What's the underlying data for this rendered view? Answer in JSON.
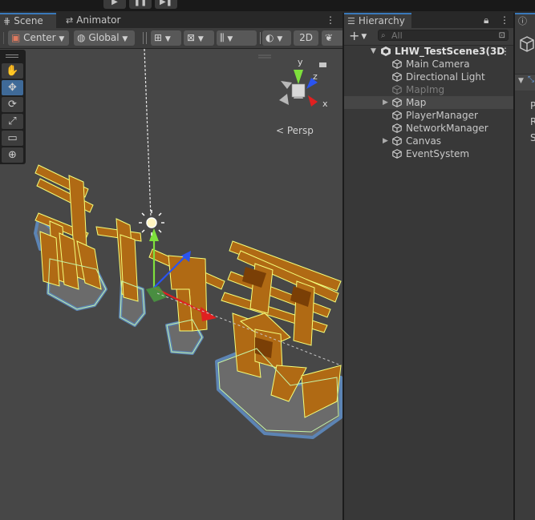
{
  "playbar": {
    "buttons": [
      "▶",
      "❚❚",
      "▶❚"
    ]
  },
  "scene_tabs": {
    "scene_label": "Scene",
    "animator_label": "Animator",
    "menu_glyph": "⋮"
  },
  "toolbar": {
    "pivot_label": "Center",
    "space_label": "Global",
    "mode_2d_label": "2D"
  },
  "scene": {
    "projection_label": "< Persp",
    "gizmo_axes": {
      "x": "x",
      "y": "y",
      "z": "z"
    }
  },
  "tools": [
    "✋",
    "✥",
    "⟳",
    "⤢",
    "▭",
    "⊕"
  ],
  "hierarchy": {
    "tab_label": "Hierarchy",
    "search_placeholder": "All",
    "add_glyph": "+",
    "scene_name": "LHW_TestScene3(3D",
    "items": [
      {
        "label": "Main Camera",
        "expandable": false,
        "inactive": false,
        "selected": false
      },
      {
        "label": "Directional Light",
        "expandable": false,
        "inactive": false,
        "selected": false
      },
      {
        "label": "MapImg",
        "expandable": false,
        "inactive": true,
        "selected": false
      },
      {
        "label": "Map",
        "expandable": true,
        "inactive": false,
        "selected": true
      },
      {
        "label": "PlayerManager",
        "expandable": false,
        "inactive": false,
        "selected": false
      },
      {
        "label": "NetworkManager",
        "expandable": false,
        "inactive": false,
        "selected": false
      },
      {
        "label": "Canvas",
        "expandable": true,
        "inactive": false,
        "selected": false
      },
      {
        "label": "EventSystem",
        "expandable": false,
        "inactive": false,
        "selected": false
      }
    ]
  },
  "inspector": {
    "partial_letters": [
      "P",
      "R",
      "S"
    ]
  },
  "colors": {
    "accent": "#3a79bb",
    "selection": "#f0a020",
    "outline": "#5c84b4"
  }
}
